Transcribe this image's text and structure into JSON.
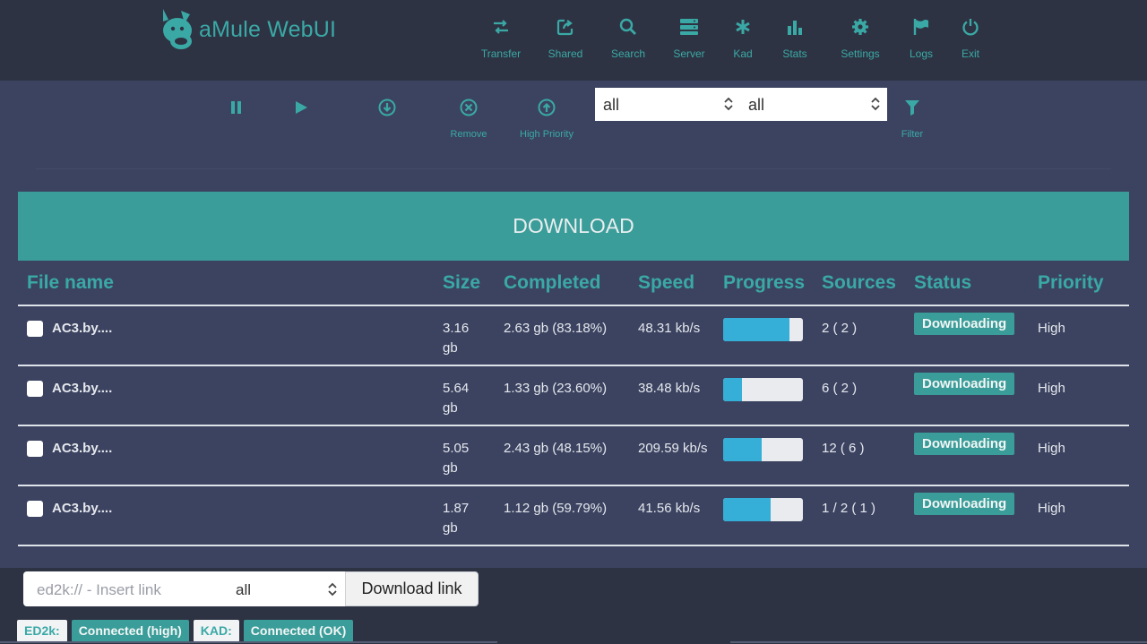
{
  "app": {
    "title": "aMule WebUI"
  },
  "nav": [
    {
      "label": "Transfer",
      "icon": "transfer-icon"
    },
    {
      "label": "Shared",
      "icon": "share-icon"
    },
    {
      "label": "Search",
      "icon": "search-icon"
    },
    {
      "label": "Server",
      "icon": "server-icon"
    },
    {
      "label": "Kad",
      "icon": "kad-icon"
    },
    {
      "label": "Stats",
      "icon": "stats-icon"
    },
    {
      "label": "Settings",
      "icon": "gear-icon"
    },
    {
      "label": "Logs",
      "icon": "flag-icon"
    },
    {
      "label": "Exit",
      "icon": "power-icon"
    }
  ],
  "toolbar": {
    "pause_icon": "pause-icon",
    "play_icon": "play-icon",
    "download_icon": "download-circle-icon",
    "remove_label": "Remove",
    "high_priority_label": "High Priority",
    "filter_label": "Filter",
    "select1_value": "all",
    "select2_value": "all"
  },
  "section": {
    "title": "DOWNLOAD"
  },
  "table": {
    "headers": [
      "File name",
      "Size",
      "Completed",
      "Speed",
      "Progress",
      "Sources",
      "Status",
      "Priority"
    ],
    "rows": [
      {
        "name": "AC3.by....",
        "size_num": "3.16",
        "size_unit": "gb",
        "completed": "2.63 gb (83.18%)",
        "speed": "48.31 kb/s",
        "progress": 0.8318,
        "sources": "2 ( 2 )",
        "status": "Downloading",
        "priority": "High"
      },
      {
        "name": "AC3.by....",
        "size_num": "5.64",
        "size_unit": "gb",
        "completed": "1.33 gb (23.60%)",
        "speed": "38.48 kb/s",
        "progress": 0.236,
        "sources": "6 ( 2 )",
        "status": "Downloading",
        "priority": "High"
      },
      {
        "name": "AC3.by....",
        "size_num": "5.05",
        "size_unit": "gb",
        "completed": "2.43 gb (48.15%)",
        "speed": "209.59 kb/s",
        "progress": 0.4815,
        "sources": "12 ( 6 )",
        "status": "Downloading",
        "priority": "High"
      },
      {
        "name": "AC3.by....",
        "size_num": "1.87",
        "size_unit": "gb",
        "completed": "1.12 gb (59.79%)",
        "speed": "41.56 kb/s",
        "progress": 0.5979,
        "sources": "1 / 2 ( 1 )",
        "status": "Downloading",
        "priority": "High"
      }
    ]
  },
  "footer": {
    "link_placeholder": "ed2k:// - Insert link",
    "link_select_value": "all",
    "download_link_label": "Download link",
    "status": [
      {
        "label": "ED2k:",
        "style": "light"
      },
      {
        "label": "Connected (high)",
        "style": "teal"
      },
      {
        "label": "KAD:",
        "style": "light"
      },
      {
        "label": "Connected (OK)",
        "style": "teal"
      }
    ]
  },
  "colors": {
    "accent": "#3aa9a6",
    "background": "#2e3343",
    "panel": "#3b4360",
    "progress": "#35afd8"
  }
}
